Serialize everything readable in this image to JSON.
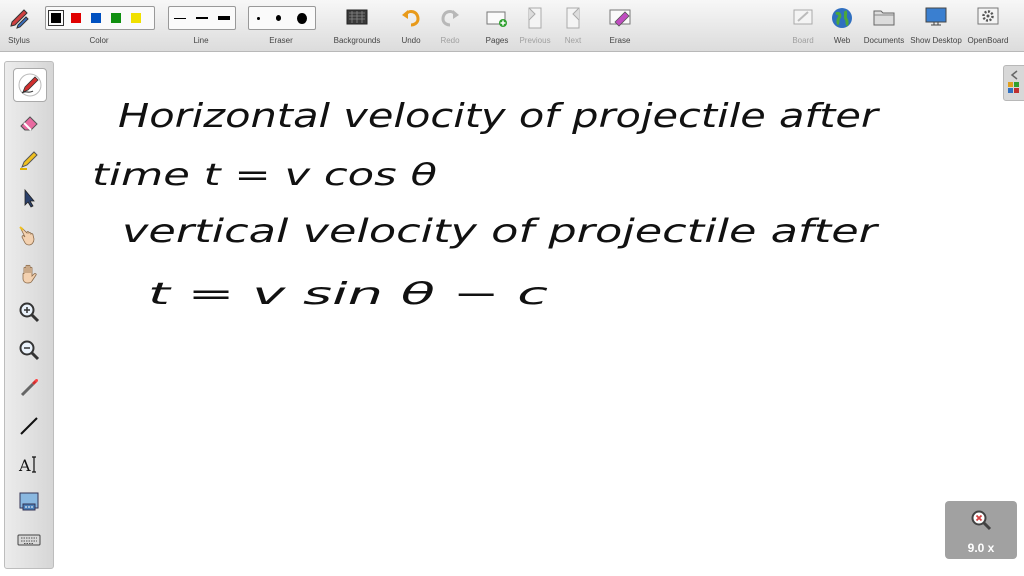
{
  "toolbar": {
    "stylus": "Stylus",
    "color": "Color",
    "line": "Line",
    "eraser": "Eraser",
    "backgrounds": "Backgrounds",
    "undo": "Undo",
    "redo": "Redo",
    "pages": "Pages",
    "previous": "Previous",
    "next": "Next",
    "erase": "Erase",
    "board": "Board",
    "web": "Web",
    "documents": "Documents",
    "show_desktop": "Show Desktop",
    "openboard": "OpenBoard"
  },
  "colors": {
    "palette": [
      "#000000",
      "#e00000",
      "#0050c0",
      "#109010",
      "#f0e000"
    ],
    "selected": "#000000"
  },
  "zoom": {
    "label": "9.0 x"
  },
  "whiteboard": {
    "line1": "Horizontal velocity of projectile after",
    "line2": "time t = v cos θ",
    "line3": "vertical velocity of projectile after",
    "line4": "t = v sin θ − c"
  }
}
